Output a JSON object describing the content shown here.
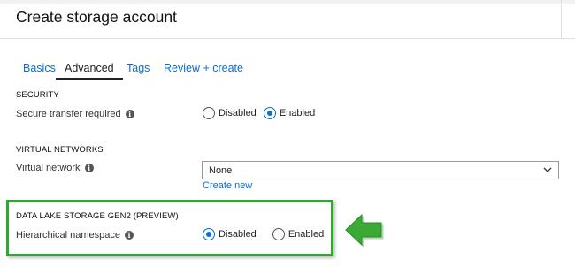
{
  "header": {
    "title": "Create storage account"
  },
  "tabs": [
    {
      "label": "Basics"
    },
    {
      "label": "Advanced"
    },
    {
      "label": "Tags"
    },
    {
      "label": "Review + create"
    }
  ],
  "active_tab": "Advanced",
  "security": {
    "heading": "SECURITY",
    "secure_transfer": {
      "label": "Secure transfer required",
      "options": [
        "Disabled",
        "Enabled"
      ],
      "selected": "Enabled"
    }
  },
  "virtual_networks": {
    "heading": "VIRTUAL NETWORKS",
    "virtual_network": {
      "label": "Virtual network",
      "selected": "None",
      "create_link": "Create new"
    }
  },
  "data_lake": {
    "heading": "DATA LAKE STORAGE GEN2 (PREVIEW)",
    "hierarchical_namespace": {
      "label": "Hierarchical namespace",
      "options": [
        "Disabled",
        "Enabled"
      ],
      "selected": "Disabled"
    }
  },
  "icons": {
    "info": "info-icon",
    "dropdown": "chevron-down-icon",
    "callout": "arrow-left-icon"
  },
  "colors": {
    "accent": "#0a6ed1",
    "highlight": "#2ea82e"
  }
}
